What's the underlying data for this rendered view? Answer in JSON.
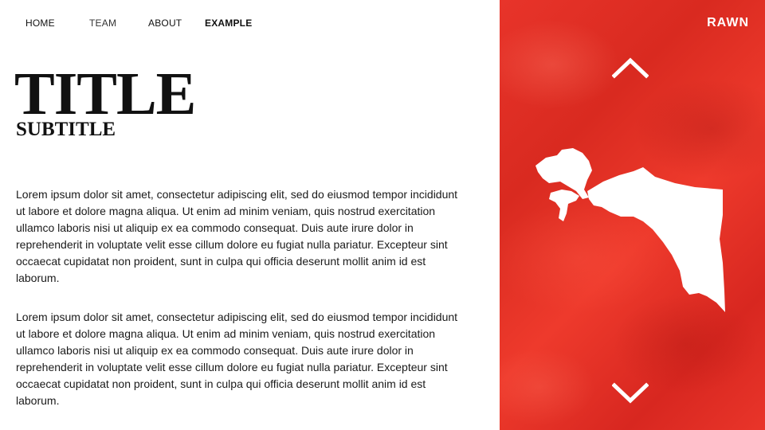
{
  "nav": {
    "items": [
      {
        "label": "HOME"
      },
      {
        "label": "TEAM"
      },
      {
        "label": "ABOUT"
      },
      {
        "label": "EXAMPLE"
      }
    ]
  },
  "header": {
    "title": "TITLE",
    "subtitle": "SUBTITLE"
  },
  "main": {
    "paragraphs": [
      "Lorem ipsum dolor sit amet, consectetur adipiscing elit, sed do eiusmod tempor incididunt ut labore et dolore magna aliqua. Ut enim ad minim veniam, quis nostrud exercitation ullamco laboris nisi ut aliquip ex ea commodo consequat. Duis aute irure dolor in reprehenderit in voluptate velit esse cillum dolore eu fugiat nulla pariatur. Excepteur sint occaecat cupidatat non proident, sunt in culpa qui officia deserunt mollit anim id est laborum.",
      "Lorem ipsum dolor sit amet, consectetur adipiscing elit, sed do eiusmod tempor incididunt ut labore et dolore magna aliqua. Ut enim ad minim veniam, quis nostrud exercitation ullamco laboris nisi ut aliquip ex ea commodo consequat. Duis aute irure dolor in reprehenderit in voluptate velit esse cillum dolore eu fugiat nulla pariatur. Excepteur sint occaecat cupidatat non proident, sunt in culpa qui officia deserunt mollit anim id est laborum."
    ]
  },
  "side_panel": {
    "brand": "RAWN",
    "accent_color": "#e2302a",
    "up_icon": "chevron-up-icon",
    "down_icon": "chevron-down-icon",
    "map_icon": "region-map-icon"
  }
}
